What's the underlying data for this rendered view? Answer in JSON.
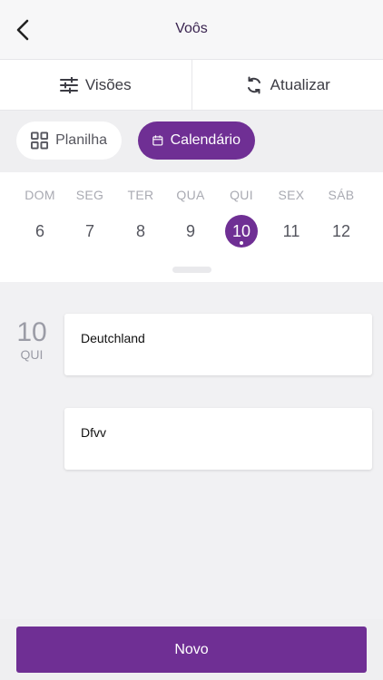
{
  "header": {
    "title": "Voôs"
  },
  "toolbar": {
    "views_label": "Visões",
    "refresh_label": "Atualizar"
  },
  "segments": {
    "sheet_label": "Planilha",
    "calendar_label": "Calendário",
    "selected": "Calendário"
  },
  "week": {
    "days": [
      {
        "name": "DOM",
        "date": "6"
      },
      {
        "name": "SEG",
        "date": "7"
      },
      {
        "name": "TER",
        "date": "8"
      },
      {
        "name": "QUA",
        "date": "9"
      },
      {
        "name": "QUI",
        "date": "10"
      },
      {
        "name": "SEX",
        "date": "11"
      },
      {
        "name": "SÁB",
        "date": "12"
      }
    ],
    "selected_index": 4
  },
  "agenda": {
    "date_number": "10",
    "date_weekday": "QUI",
    "records": [
      "Deutchland",
      "Dfvv"
    ]
  },
  "footer": {
    "new_label": "Novo"
  },
  "colors": {
    "accent": "#6f2f94",
    "background": "#f1f1f3"
  }
}
